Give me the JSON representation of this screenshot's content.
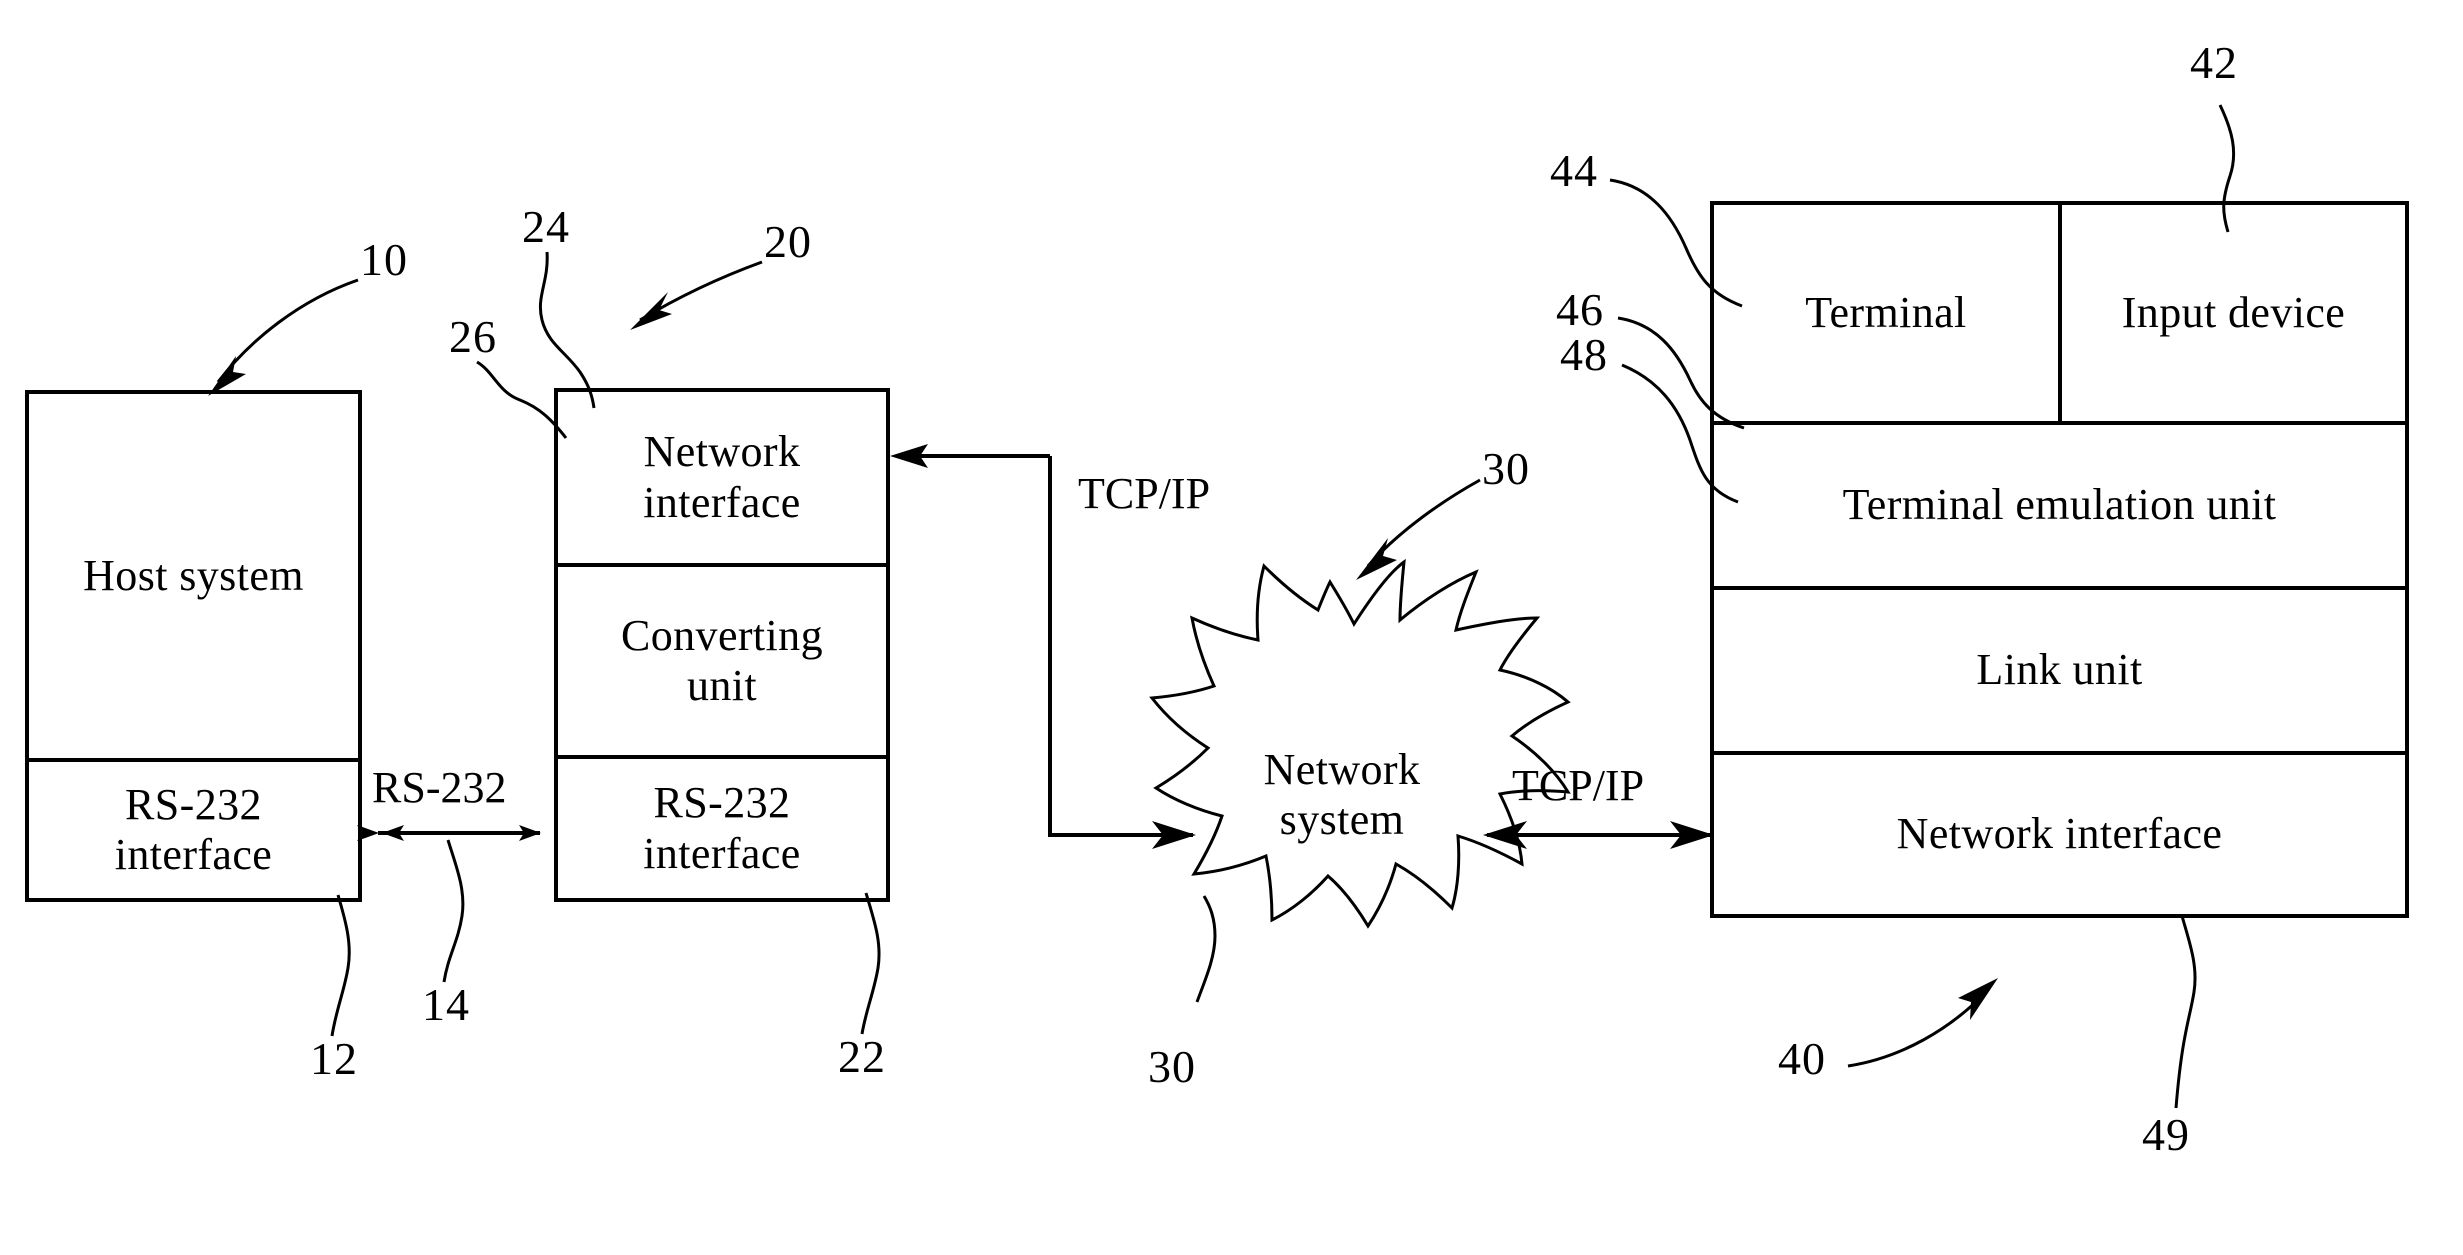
{
  "figure": {
    "type": "patent-block-diagram",
    "background_color": "#ffffff",
    "line_color": "#000000"
  },
  "blocks": {
    "host_system": {
      "label": "Host system"
    },
    "host_rs232": {
      "label": "RS-232\ninterface"
    },
    "converter_network_interface": {
      "label": "Network\ninterface"
    },
    "converter_converting_unit": {
      "label": "Converting\nunit"
    },
    "converter_rs232": {
      "label": "RS-232\ninterface"
    },
    "network_system": {
      "label": "Network\nsystem"
    },
    "terminal": {
      "label": "Terminal"
    },
    "input_device": {
      "label": "Input device"
    },
    "terminal_emulation_unit": {
      "label": "Terminal emulation unit"
    },
    "link_unit": {
      "label": "Link unit"
    },
    "client_network_interface": {
      "label": "Network interface"
    }
  },
  "connection_labels": {
    "rs232_link": "RS-232",
    "tcpip_left": "TCP/IP",
    "tcpip_right": "TCP/IP"
  },
  "reference_numerals": {
    "n10": "10",
    "n12": "12",
    "n14": "14",
    "n20": "20",
    "n22": "22",
    "n24": "24",
    "n26": "26",
    "n30_top": "30",
    "n30_bottom": "30",
    "n40": "40",
    "n42": "42",
    "n44": "44",
    "n46": "46",
    "n48": "48",
    "n49": "49"
  }
}
